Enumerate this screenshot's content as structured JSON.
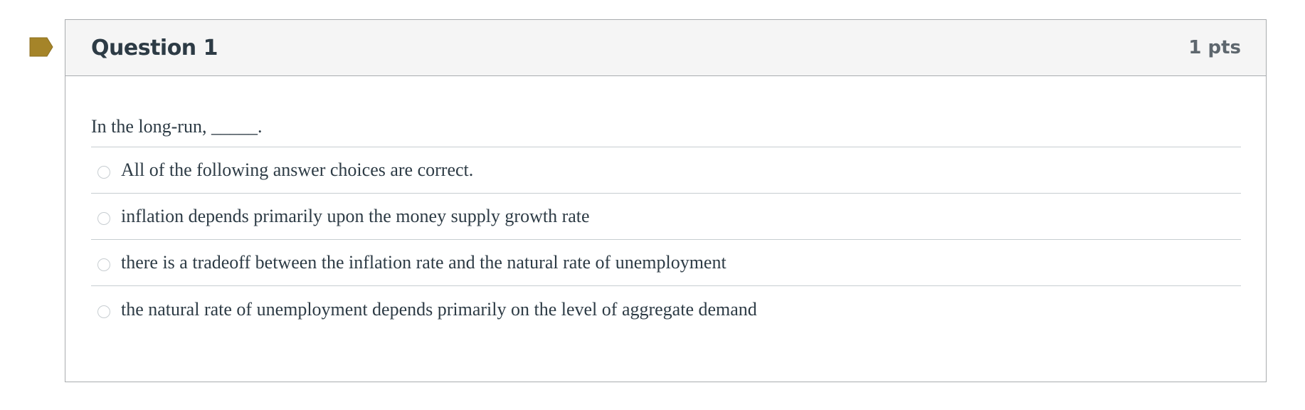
{
  "colors": {
    "flag": "#a58429",
    "header_bg": "#f5f5f5",
    "text": "#2d3b45",
    "points_text": "#5e676e",
    "border": "#a9acaf",
    "divider": "#c7cdd1"
  },
  "flag": {
    "icon": "flag-icon"
  },
  "question": {
    "title": "Question 1",
    "points": "1 pts",
    "text": "In the long-run, _____.",
    "answers": [
      {
        "label": "All of the following answer choices are correct.",
        "selected": false
      },
      {
        "label": "inflation depends primarily upon the money supply growth rate",
        "selected": false
      },
      {
        "label": "there is a tradeoff between the inflation rate and the natural rate of unemployment",
        "selected": false
      },
      {
        "label": "the natural rate of unemployment depends primarily on the level of aggregate demand",
        "selected": false
      }
    ]
  }
}
